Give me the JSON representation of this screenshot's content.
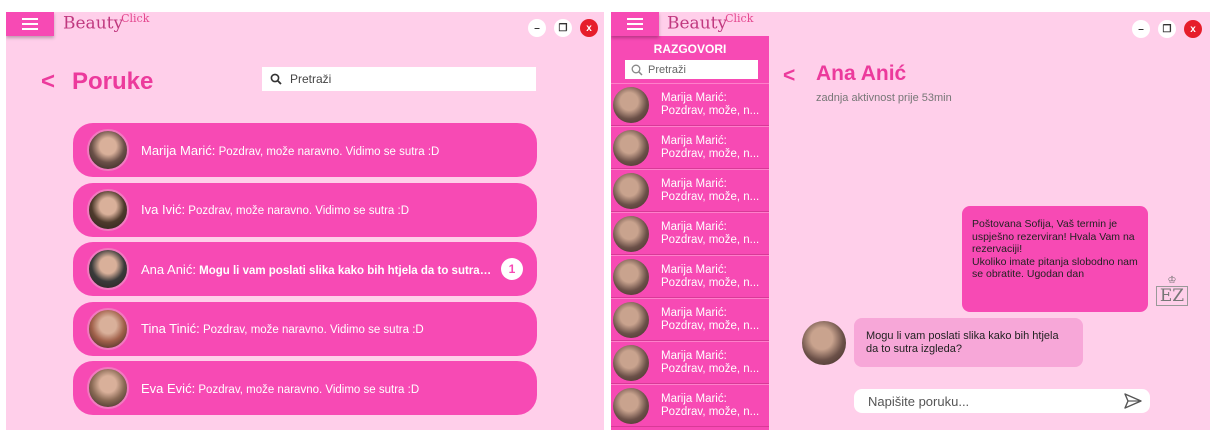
{
  "app": {
    "logo_text": "Beauty",
    "logo_superscript": "Click"
  },
  "window_controls": {
    "minimize": "–",
    "restore": "❐",
    "close": "x"
  },
  "inbox": {
    "back_glyph": "<",
    "title": "Poruke",
    "search_placeholder": "Pretraži",
    "conversations": [
      {
        "name": "Marija Marić:",
        "preview": "Pozdrav, može naravno. Vidimo se sutra :D",
        "unread": false,
        "avatar_color": "#6b5048"
      },
      {
        "name": "Iva Ivić:",
        "preview": "Pozdrav, može naravno. Vidimo se sutra :D",
        "unread": false,
        "avatar_color": "#4e3a2c"
      },
      {
        "name": "Ana Anić:",
        "preview": "Mogu li vam poslati slika kako bih htjela da to sutra iz...",
        "unread": true,
        "badge": "1",
        "avatar_color": "#3a3a3a"
      },
      {
        "name": "Tina Tinić:",
        "preview": "Pozdrav, može naravno. Vidimo se sutra :D",
        "unread": false,
        "avatar_color": "#a0604a"
      },
      {
        "name": "Eva Ević:",
        "preview": "Pozdrav, može naravno. Vidimo se sutra :D",
        "unread": false,
        "avatar_color": "#8a6a55"
      }
    ]
  },
  "chat": {
    "sidebar_title": "RAZGOVORI",
    "sidebar_search_placeholder": "Pretraži",
    "sidebar_items": [
      {
        "line1": "Marija Marić:",
        "line2": "Pozdrav, može, n..."
      },
      {
        "line1": "Marija Marić:",
        "line2": "Pozdrav, može, n..."
      },
      {
        "line1": "Marija Marić:",
        "line2": "Pozdrav, može, n..."
      },
      {
        "line1": "Marija Marić:",
        "line2": "Pozdrav, može, n..."
      },
      {
        "line1": "Marija Marić:",
        "line2": "Pozdrav, može, n..."
      },
      {
        "line1": "Marija Marić:",
        "line2": "Pozdrav, može, n..."
      },
      {
        "line1": "Marija Marić:",
        "line2": "Pozdrav, može, n..."
      },
      {
        "line1": "Marija Marić:",
        "line2": "Pozdrav, može, n..."
      }
    ],
    "back_glyph": "<",
    "contact_name": "Ana Anić",
    "last_active": "zadnja aktivnost prije 53min",
    "outgoing_message": "Poštovana Sofija, Vaš termin je uspješno rezerviran! Hvala Vam na rezervaciji!\nUkoliko imate pitanja slobodno nam se obratite. Ugodan dan",
    "incoming_message": "Mogu li vam poslati slika kako bih htjela da to sutra izgleda?",
    "salon_logo_text": "EZ",
    "compose_placeholder": "Napišite poruku..."
  },
  "colors": {
    "panel_bg": "#ffcfea",
    "accent": "#f74ab4",
    "title_pink": "#ec3a9c",
    "incoming_bubble": "#f7a7d8",
    "close_red": "#e61e2b"
  }
}
